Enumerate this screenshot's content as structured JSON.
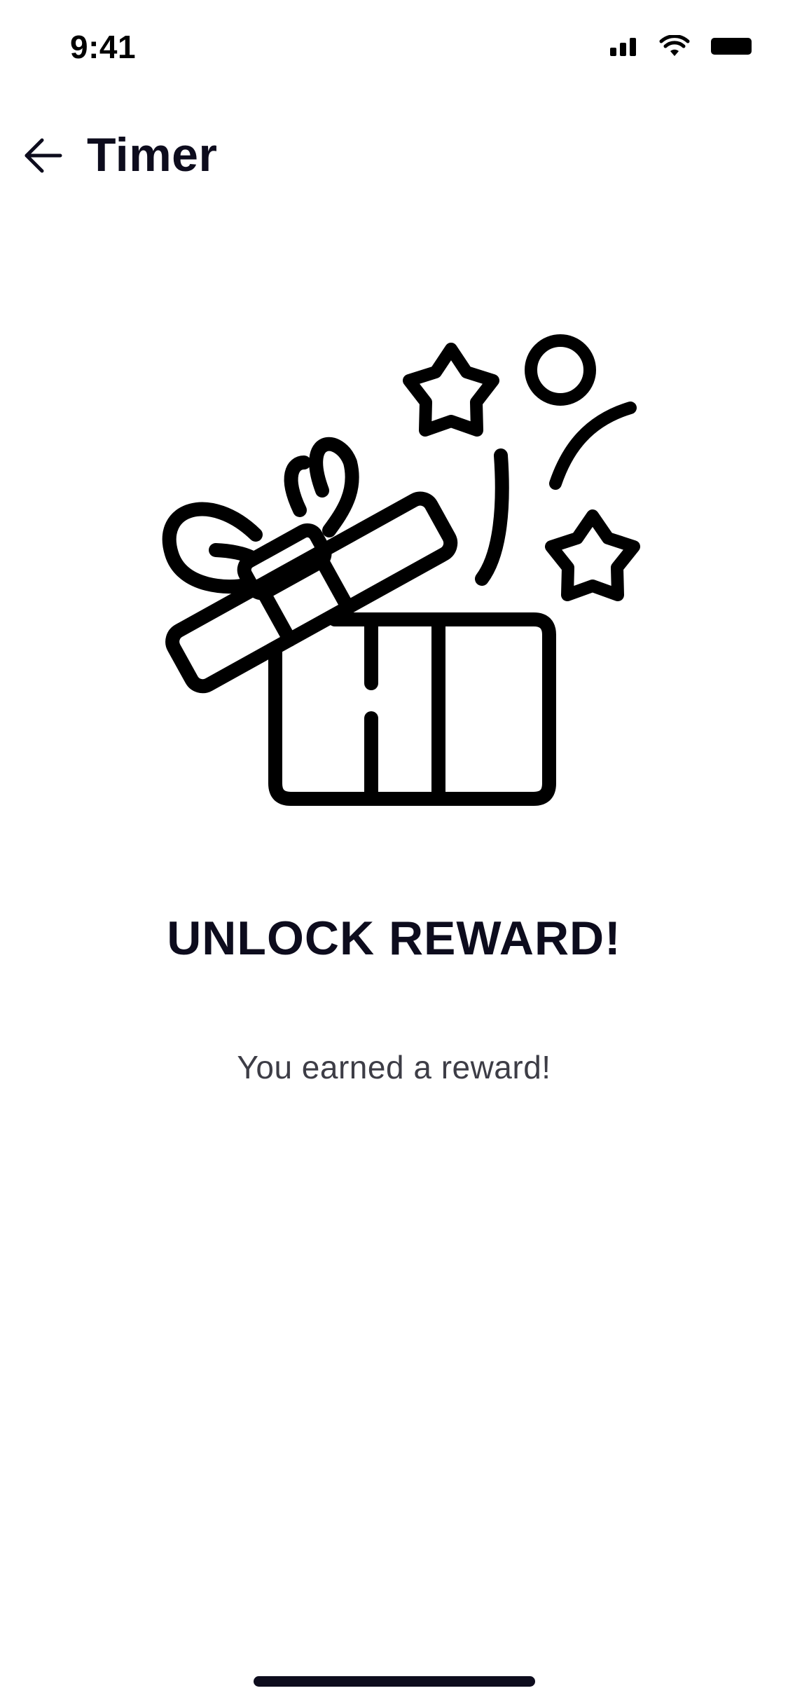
{
  "status_bar": {
    "time": "9:41",
    "icons": [
      "signal-icon",
      "wifi-icon",
      "battery-icon"
    ]
  },
  "header": {
    "back_icon": "arrow-left-icon",
    "title": "Timer"
  },
  "illustration": {
    "icon": "open-gift-box-icon",
    "decorations": [
      "star-icon",
      "star-icon",
      "circle-icon",
      "confetti-curve-icon"
    ]
  },
  "reward": {
    "title": "UNLOCK REWARD!",
    "subtitle": "You earned a reward!"
  },
  "colors": {
    "background": "#ffffff",
    "text_primary": "#0d0c1d",
    "text_secondary": "#3d3d46",
    "icon_stroke": "#000000"
  }
}
